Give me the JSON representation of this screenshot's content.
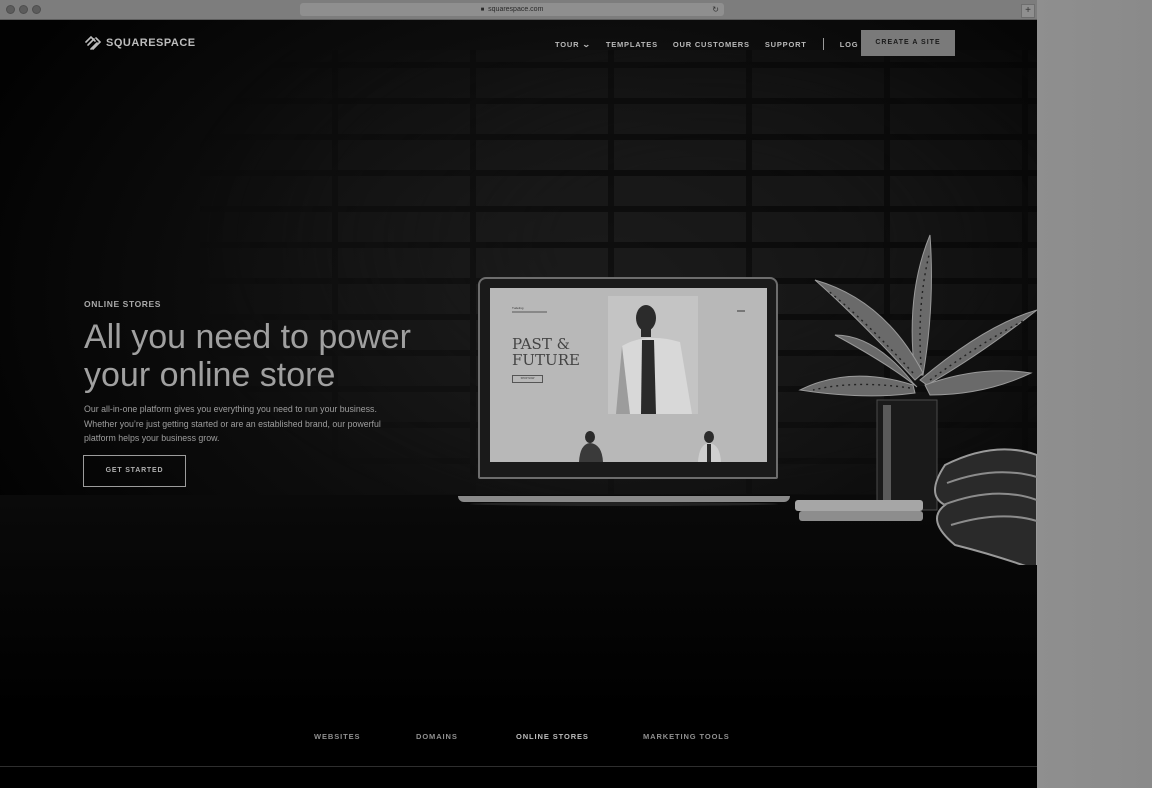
{
  "browser": {
    "url": "squarespace.com",
    "new_tab_icon": "+"
  },
  "header": {
    "logo_text": "SQUARESPACE",
    "nav": {
      "tour": "TOUR",
      "templates": "TEMPLATES",
      "customers": "OUR CUSTOMERS",
      "support": "SUPPORT",
      "login": "LOG IN"
    },
    "cta": "CREATE A SITE"
  },
  "hero": {
    "eyebrow": "ONLINE STORES",
    "headline": "All you need to power your online store",
    "description": "Our all-in-one platform gives you everything you need to run your business. Whether you’re just getting started or are an established brand, our powerful platform helps your business grow.",
    "button": "GET STARTED"
  },
  "laptop_screen": {
    "brand": "Tudeling",
    "headline_line1": "PAST &",
    "headline_line2": "FUTURE",
    "button": "SHOP NOW"
  },
  "subnav": {
    "items": [
      "WEBSITES",
      "DOMAINS",
      "ONLINE STORES",
      "MARKETING TOOLS"
    ],
    "active": "ONLINE STORES"
  },
  "colors": {
    "page_bg": "#000000",
    "accent_button": "#7a7a7a",
    "text_muted": "#a0a0a0"
  }
}
